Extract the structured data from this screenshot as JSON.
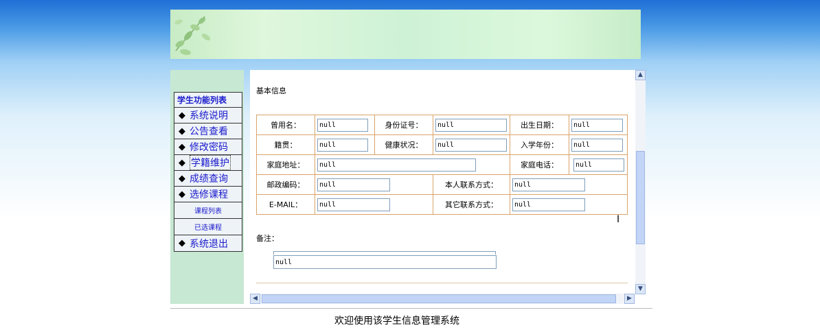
{
  "menu": {
    "header": "学生功能列表",
    "items": [
      {
        "label": "系统说明",
        "type": "main"
      },
      {
        "label": "公告查看",
        "type": "main"
      },
      {
        "label": "修改密码",
        "type": "main"
      },
      {
        "label": "学籍维护",
        "type": "main"
      },
      {
        "label": "成绩查询",
        "type": "main"
      },
      {
        "label": "选修课程",
        "type": "main"
      },
      {
        "label": "课程列表",
        "type": "sub"
      },
      {
        "label": "已选课程",
        "type": "sub"
      },
      {
        "label": "系统退出",
        "type": "main"
      }
    ],
    "bullet": "◆"
  },
  "section_title": "基本信息",
  "form": {
    "used_name_label": "曾用名：",
    "used_name_value": "null",
    "id_card_label": "身份证号：",
    "id_card_value": "null",
    "birth_label": "出生日期：",
    "birth_value": "null",
    "native_label": "籍贯：",
    "native_value": "null",
    "health_label": "健康状况：",
    "health_value": "null",
    "entry_year_label": "入学年份：",
    "entry_year_value": "null",
    "address_label": "家庭地址：",
    "address_value": "null",
    "home_phone_label": "家庭电话：",
    "home_phone_value": "null",
    "postcode_label": "邮政编码：",
    "postcode_value": "null",
    "contact_label": "本人联系方式：",
    "contact_value": "null",
    "email_label": "E-MAIL：",
    "email_value": "null",
    "other_contact_label": "其它联系方式：",
    "other_contact_value": "null"
  },
  "remark": {
    "label": "备注：",
    "value": "null"
  },
  "footer": "欢迎使用该学生信息管理系统"
}
